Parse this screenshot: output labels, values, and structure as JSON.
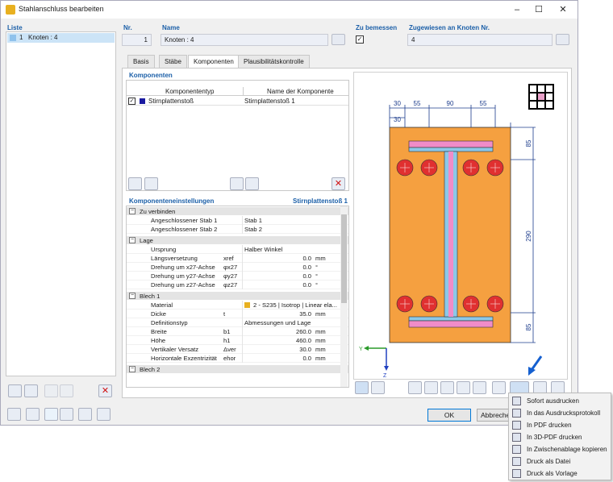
{
  "window": {
    "title": "Stahlanschluss bearbeiten",
    "minimize": "–",
    "maximize": "☐",
    "close": "✕"
  },
  "list": {
    "header": "Liste",
    "items": [
      {
        "num": "1",
        "label": "Knoten : 4"
      }
    ]
  },
  "fields": {
    "nr_label": "Nr.",
    "nr_value": "1",
    "name_label": "Name",
    "name_value": "Knoten : 4",
    "design_label": "Zu bemessen",
    "assigned_label": "Zugewiesen an Knoten Nr.",
    "assigned_value": "4"
  },
  "tabs": [
    "Basis",
    "Stäbe",
    "Komponenten",
    "Plausibilitätskontrolle"
  ],
  "components": {
    "header": "Komponenten",
    "col_type": "Komponententyp",
    "col_name": "Name der Komponente",
    "rows": [
      {
        "type": "Stirnplattenstoß",
        "name": "Stirnplattenstoß 1"
      }
    ]
  },
  "settings": {
    "header": "Komponenteneinstellungen",
    "current": "Stirnplattenstoß 1",
    "sections": [
      {
        "title": "Zu verbinden",
        "rows": [
          {
            "label": "Angeschlossener Stab 1",
            "sym": "",
            "val": "Stab 1",
            "unit": ""
          },
          {
            "label": "Angeschlossener Stab 2",
            "sym": "",
            "val": "Stab 2",
            "unit": ""
          }
        ]
      },
      {
        "title": "Lage",
        "rows": [
          {
            "label": "Ursprung",
            "sym": "",
            "val": "Halber Winkel",
            "unit": ""
          },
          {
            "label": "Längsversetzung",
            "sym": "xref",
            "val": "0.0",
            "unit": "mm"
          },
          {
            "label": "Drehung um x27-Achse",
            "sym": "φx27",
            "val": "0.0",
            "unit": "°"
          },
          {
            "label": "Drehung um y27-Achse",
            "sym": "φy27",
            "val": "0.0",
            "unit": "°"
          },
          {
            "label": "Drehung um z27-Achse",
            "sym": "φz27",
            "val": "0.0",
            "unit": "°"
          }
        ]
      },
      {
        "title": "Blech 1",
        "rows": [
          {
            "label": "Material",
            "sym": "",
            "val": "2 - S235 | Isotrop | Linear ela...",
            "unit": ""
          },
          {
            "label": "Dicke",
            "sym": "t",
            "val": "35.0",
            "unit": "mm"
          },
          {
            "label": "Definitionstyp",
            "sym": "",
            "val": "Abmessungen und Lage",
            "unit": ""
          },
          {
            "label": "Breite",
            "sym": "b1",
            "val": "260.0",
            "unit": "mm"
          },
          {
            "label": "Höhe",
            "sym": "h1",
            "val": "460.0",
            "unit": "mm"
          },
          {
            "label": "Vertikaler Versatz",
            "sym": "Δver",
            "val": "30.0",
            "unit": "mm"
          },
          {
            "label": "Horizontale Exzentrizität",
            "sym": "ehor",
            "val": "0.0",
            "unit": "mm"
          }
        ]
      },
      {
        "title": "Blech 2",
        "rows": []
      }
    ]
  },
  "drawing": {
    "dims_top": [
      "30",
      "55",
      "90",
      "55"
    ],
    "dims_right": [
      "85",
      "290",
      "85"
    ],
    "axis_y": "Y",
    "axis_z": "Z"
  },
  "buttons": {
    "ok": "OK",
    "cancel": "Abbreche"
  },
  "menu": {
    "items": [
      "Sofort ausdrucken",
      "In das Ausdrucksprotokoll",
      "In PDF drucken",
      "In 3D-PDF drucken",
      "In Zwischenablage kopieren",
      "Druck als Datei",
      "Druck als Vorlage"
    ]
  },
  "colors": {
    "plate": "#f5a040",
    "bolt": "#e03030",
    "flange_pink": "#f08cc8",
    "web_blue": "#8cc8e8",
    "dim": "#1c3c8c",
    "accent_blue": "#1b5fa8"
  }
}
